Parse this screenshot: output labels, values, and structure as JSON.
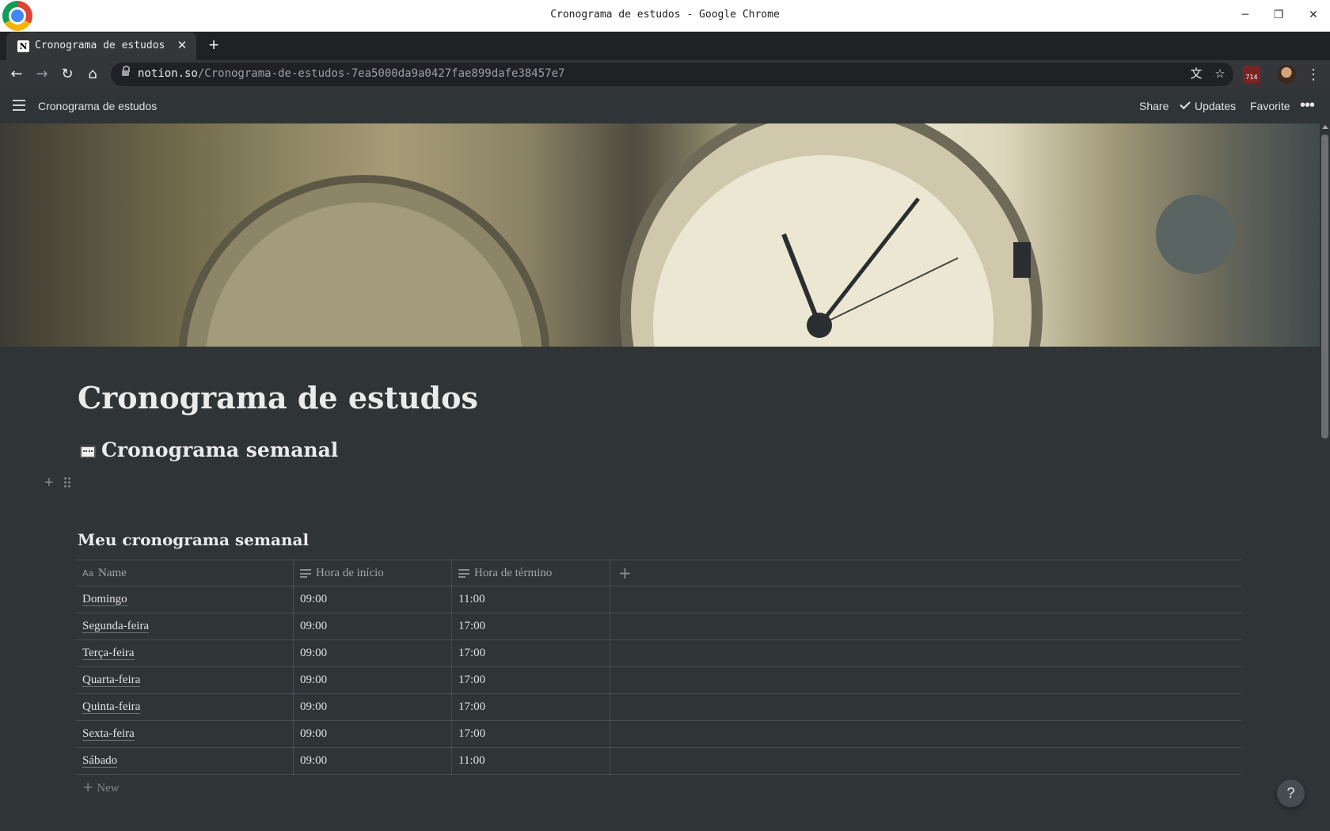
{
  "window": {
    "title": "Cronograma de estudos - Google Chrome",
    "minimize": "─",
    "restore": "❐",
    "close": "✕"
  },
  "tab": {
    "title": "Cronograma de estudos",
    "favicon": "N",
    "close": "✕",
    "new_tab": "+"
  },
  "toolbar": {
    "back": "←",
    "forward": "→",
    "reload": "↻",
    "home": "⌂",
    "url_host": "notion.so",
    "url_path": "/Cronograma-de-estudos-7ea5000da9a0427fae899dafe38457e7",
    "translate_icon": "文",
    "bookmark_icon": "☆",
    "extension_badge": "714",
    "menu": "⋮"
  },
  "notion_topbar": {
    "breadcrumb": "Cronograma de estudos",
    "share": "Share",
    "updates": "Updates",
    "favorite": "Favorite",
    "more": "•••"
  },
  "page": {
    "title": "Cronograma de estudos",
    "heading": "Cronograma semanal",
    "add_block": "+"
  },
  "database": {
    "title": "Meu cronograma semanal",
    "columns": [
      "Name",
      "Hora de início",
      "Hora de término"
    ],
    "add_column": "+",
    "rows": [
      {
        "name": "Domingo",
        "start": "09:00",
        "end": "11:00"
      },
      {
        "name": "Segunda-feira",
        "start": "09:00",
        "end": "17:00"
      },
      {
        "name": "Terça-feira",
        "start": "09:00",
        "end": "17:00"
      },
      {
        "name": "Quarta-feira",
        "start": "09:00",
        "end": "17:00"
      },
      {
        "name": "Quinta-feira",
        "start": "09:00",
        "end": "17:00"
      },
      {
        "name": "Sexta-feira",
        "start": "09:00",
        "end": "17:00"
      },
      {
        "name": "Sábado",
        "start": "09:00",
        "end": "11:00"
      }
    ],
    "new_row": "New",
    "new_row_plus": "+",
    "column_icon_name": "Aa"
  },
  "help": "?"
}
